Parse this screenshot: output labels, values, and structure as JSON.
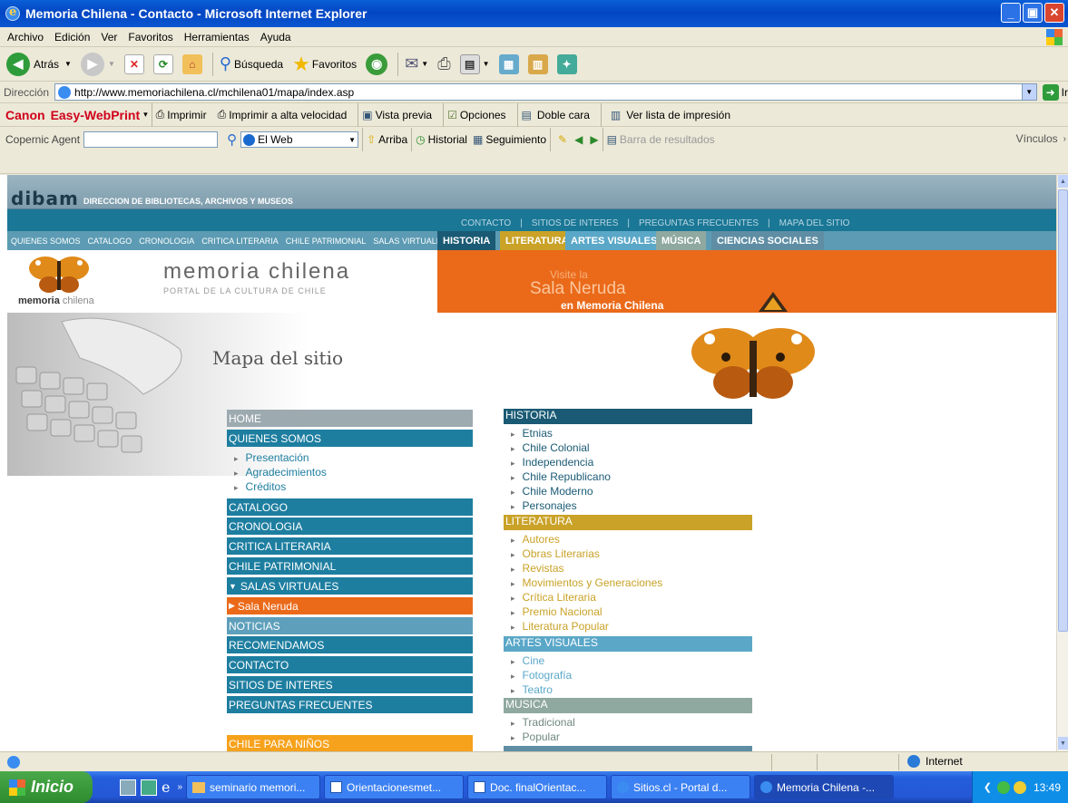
{
  "window": {
    "title": "Memoria Chilena - Contacto - Microsoft Internet Explorer"
  },
  "menu": [
    "Archivo",
    "Edición",
    "Ver",
    "Favoritos",
    "Herramientas",
    "Ayuda"
  ],
  "toolbar": {
    "back": "Atrás",
    "search": "Búsqueda",
    "favorites": "Favoritos"
  },
  "address": {
    "label": "Dirección",
    "url": "http://www.memoriachilena.cl/mchilena01/mapa/index.asp",
    "go": "Ir"
  },
  "canon": {
    "brand": "Canon",
    "app": "Easy-WebPrint",
    "print": "Imprimir",
    "print_fast": "Imprimir a alta velocidad",
    "preview": "Vista previa",
    "options": "Opciones",
    "duplex": "Doble cara",
    "list": "Ver lista de impresión"
  },
  "copernic": {
    "label": "Copernic Agent",
    "scope": "El Web",
    "up": "Arriba",
    "history": "Historial",
    "tracking": "Seguimiento",
    "results": "Barra de resultados",
    "links": "Vínculos"
  },
  "site": {
    "dibam_logo": "dibam",
    "dibam_text": "DIRECCION DE BIBLIOTECAS, ARCHIVOS Y MUSEOS",
    "top_links": [
      "CONTACTO",
      "SITIOS DE INTERES",
      "PREGUNTAS FRECUENTES",
      "MAPA DEL SITIO"
    ],
    "top_sep": "|",
    "left_nav": [
      "QUIENES SOMOS",
      "CATALOGO",
      "CRONOLOGIA",
      "CRITICA LITERARIA",
      "CHILE PATRIMONIAL",
      "SALAS VIRTUALES"
    ],
    "tabs": [
      "HISTORIA",
      "LITERATURA",
      "ARTES VISUALES",
      "MÚSICA",
      "CIENCIAS SOCIALES"
    ],
    "brand_title": "memoria chilena",
    "brand_sub": "PORTAL DE LA CULTURA DE CHILE",
    "brand_small_1": "memoria",
    "brand_small_2": "chilena",
    "banner_1": "Visite la",
    "banner_2": "Sala Neruda",
    "banner_3": "en Memoria Chilena",
    "page_title": "Mapa del sitio",
    "menu": {
      "home": "HOME",
      "quienes": "QUIENES SOMOS",
      "quienes_sub": [
        "Presentación",
        "Agradecimientos",
        "Créditos"
      ],
      "catalogo": "CATALOGO",
      "cronologia": "CRONOLOGIA",
      "critica": "CRITICA LITERARIA",
      "patrimonial": "CHILE PATRIMONIAL",
      "salas": "SALAS VIRTUALES",
      "neruda": "Sala Neruda",
      "noticias": "NOTICIAS",
      "recomendamos": "RECOMENDAMOS",
      "contacto": "CONTACTO",
      "sitios": "SITIOS DE INTERES",
      "preguntas": "PREGUNTAS FRECUENTES",
      "ninos": "CHILE PARA NIÑOS"
    },
    "historia": {
      "title": "HISTORIA",
      "items": [
        "Etnias",
        "Chile Colonial",
        "Independencia",
        "Chile Republicano",
        "Chile Moderno",
        "Personajes"
      ]
    },
    "literatura": {
      "title": "LITERATURA",
      "items": [
        "Autores",
        "Obras Literarias",
        "Revistas",
        "Movimientos y Generaciones",
        "Crítica Literaria",
        "Premio Nacional",
        "Literatura Popular"
      ]
    },
    "artes": {
      "title": "ARTES VISUALES",
      "items": [
        "Cine",
        "Fotografía",
        "Teatro"
      ]
    },
    "musica": {
      "title": "MUSICA",
      "items": [
        "Tradicional",
        "Popular"
      ]
    }
  },
  "status": {
    "zone": "Internet"
  },
  "taskbar": {
    "start": "Inicio",
    "tasks": [
      "seminario memori...",
      "Orientacionesmet...",
      "Doc. finalOrientac...",
      "Sitios.cl - Portal d...",
      "Memoria Chilena -..."
    ],
    "time": "13:49"
  },
  "colors": {
    "accent_blue": "#1a7795",
    "orange": "#ea6a1a",
    "gold": "#c9a227",
    "light_blue": "#5aa7c8",
    "gray_green": "#8fa8a0"
  }
}
